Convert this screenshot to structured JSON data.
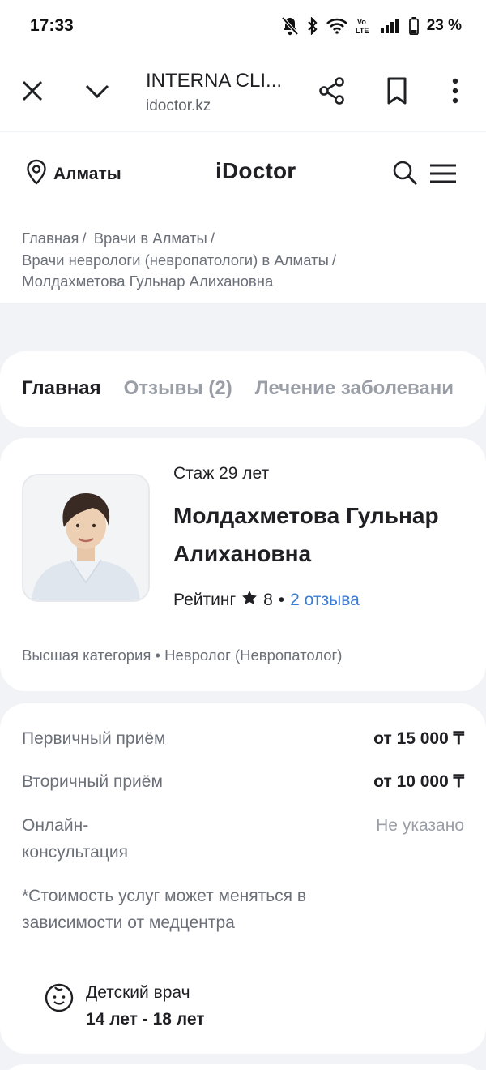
{
  "status_bar": {
    "time": "17:33",
    "battery": "23 %",
    "icons": [
      "bell-muted-icon",
      "bluetooth-icon",
      "wifi-icon",
      "volte-icon",
      "signal-icon",
      "battery-icon"
    ]
  },
  "browser": {
    "page_title": "INTERNA CLI...",
    "url": "idoctor.kz",
    "icons": [
      "close-icon",
      "chevron-down-icon",
      "share-icon",
      "bookmark-icon",
      "more-vert-icon"
    ]
  },
  "header": {
    "city": "Алматы",
    "logo": "iDoctor",
    "icons": [
      "location-pin-icon",
      "search-icon",
      "hamburger-menu-icon"
    ]
  },
  "breadcrumb": [
    "Главная",
    "Врачи в Алматы",
    "Врачи неврологи (невропатологи) в Алматы",
    "Молдахметова Гульнар Алихановна"
  ],
  "breadcrumb_separator": "/",
  "tabs": [
    {
      "label": "Главная",
      "active": true
    },
    {
      "label": "Отзывы (2)",
      "active": false
    },
    {
      "label": "Лечение заболевани",
      "active": false
    }
  ],
  "doctor": {
    "experience": "Стаж 29 лет",
    "name_line1": "Молдахметова Гульнар",
    "name_line2": "Алихановна",
    "rating_label": "Рейтинг",
    "rating_value": "8",
    "rating_dot": "•",
    "reviews_link": "2 отзыва",
    "category": "Высшая категория • Невролог (Невропатолог)"
  },
  "prices": {
    "rows": [
      {
        "label": "Первичный приём",
        "value": "от 15 000 ₸"
      },
      {
        "label": "Вторичный приём",
        "value": "от 10 000 ₸"
      },
      {
        "label_line1": "Онлайн-",
        "label_line2": "консультация",
        "value": "Не указано"
      }
    ],
    "note_line1": "*Стоимость услуг может меняться в",
    "note_line2": "зависимости от медцентра"
  },
  "child_doctor": {
    "title": "Детский врач",
    "ages": "14 лет - 18 лет",
    "icon": "baby-face-icon"
  },
  "colors": {
    "link": "#3a7bd5",
    "page_bg": "#f2f3f6",
    "muted_text": "#6b6f78"
  }
}
